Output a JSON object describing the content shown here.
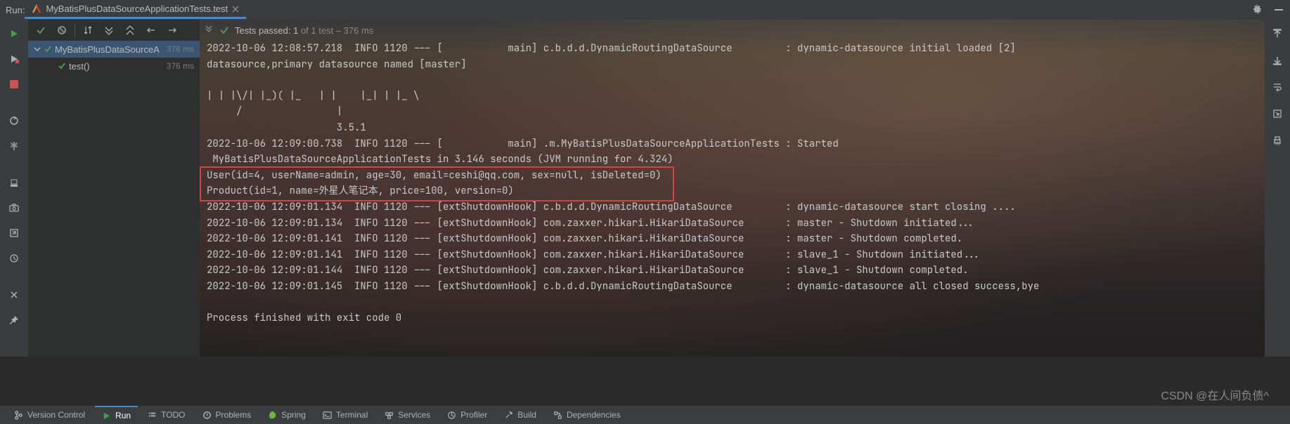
{
  "header": {
    "panel_label": "Run:",
    "tab_title": "MyBatisPlusDataSourceApplicationTests.test"
  },
  "console_toolbar": {
    "tests_prefix": "Tests passed: 1",
    "tests_suffix": " of 1 test – 376 ms"
  },
  "tree": {
    "root": {
      "label": "MyBatisPlusDataSourceA",
      "time": "376 ms"
    },
    "child": {
      "label": "test()",
      "time": "376 ms"
    }
  },
  "console_lines": [
    "2022-10-06 12:08:57.218  INFO 1120 --- [           main] c.b.d.d.DynamicRoutingDataSource         : dynamic-datasource initial loaded [2]",
    "datasource,primary datasource named [master]",
    "",
    "| | |\\/| |_)( |_   | |    |_| | |_ \\",
    "     /                |",
    "                      3.5.1",
    "2022-10-06 12:09:00.738  INFO 1120 --- [           main] .m.MyBatisPlusDataSourceApplicationTests : Started",
    " MyBatisPlusDataSourceApplicationTests in 3.146 seconds (JVM running for 4.324)",
    "User(id=4, userName=admin, age=30, email=ceshi@qq.com, sex=null, isDeleted=0)",
    "Product(id=1, name=外星人笔记本, price=100, version=0)",
    "2022-10-06 12:09:01.134  INFO 1120 --- [extShutdownHook] c.b.d.d.DynamicRoutingDataSource         : dynamic-datasource start closing ....",
    "2022-10-06 12:09:01.134  INFO 1120 --- [extShutdownHook] com.zaxxer.hikari.HikariDataSource       : master - Shutdown initiated...",
    "2022-10-06 12:09:01.141  INFO 1120 --- [extShutdownHook] com.zaxxer.hikari.HikariDataSource       : master - Shutdown completed.",
    "2022-10-06 12:09:01.141  INFO 1120 --- [extShutdownHook] com.zaxxer.hikari.HikariDataSource       : slave_1 - Shutdown initiated...",
    "2022-10-06 12:09:01.144  INFO 1120 --- [extShutdownHook] com.zaxxer.hikari.HikariDataSource       : slave_1 - Shutdown completed.",
    "2022-10-06 12:09:01.145  INFO 1120 --- [extShutdownHook] c.b.d.d.DynamicRoutingDataSource         : dynamic-datasource all closed success,bye",
    "",
    "Process finished with exit code 0"
  ],
  "bottom": {
    "vcs": "Version Control",
    "run": "Run",
    "todo": "TODO",
    "problems": "Problems",
    "spring": "Spring",
    "terminal": "Terminal",
    "services": "Services",
    "profiler": "Profiler",
    "build": "Build",
    "deps": "Dependencies"
  },
  "watermark": "CSDN @在人间负债^"
}
